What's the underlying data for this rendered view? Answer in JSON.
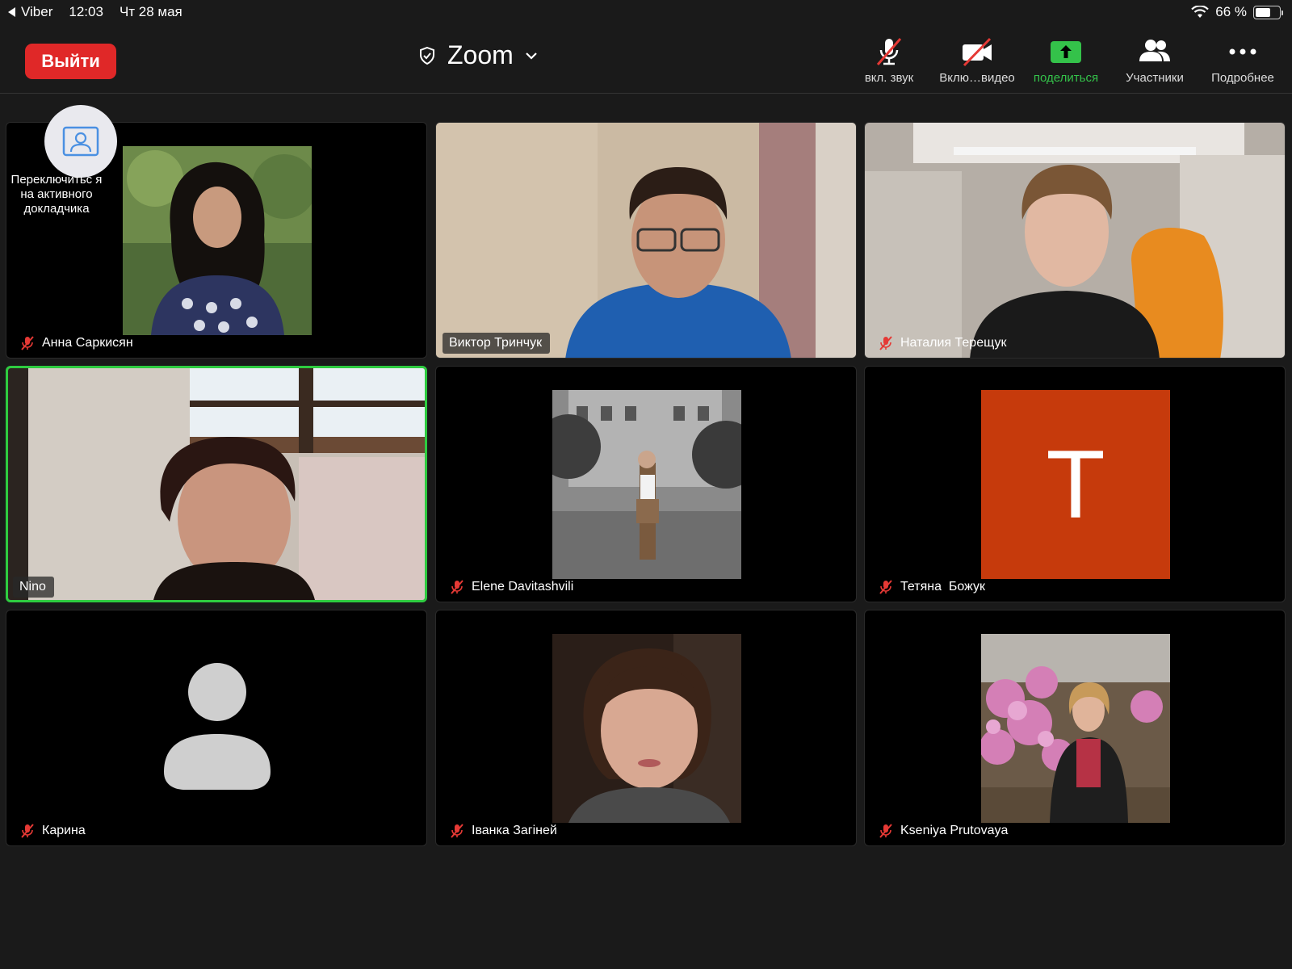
{
  "status_bar": {
    "back_app": "Viber",
    "time": "12:03",
    "date": "Чт 28 мая",
    "battery": "66 %",
    "battery_level": 0.66
  },
  "toolbar": {
    "leave_label": "Выйти",
    "title": "Zoom",
    "buttons": [
      {
        "label": "вкл. звук",
        "icon": "microphone-muted-icon"
      },
      {
        "label": "Вклю…видео",
        "icon": "camera-off-icon"
      },
      {
        "label": "поделиться",
        "icon": "share-screen-icon"
      },
      {
        "label": "Участники",
        "icon": "participants-icon"
      },
      {
        "label": "Подробнее",
        "icon": "more-icon"
      }
    ]
  },
  "speaker_switch": {
    "label": "Переключитьс я на активного докладчика"
  },
  "colors": {
    "leave": "#e02828",
    "share": "#34c24a",
    "active_border": "#2ecc40",
    "mute_red": "#e53935",
    "avatar_t_bg": "#c63a0c"
  },
  "participants": [
    {
      "name": "Анна Саркисян",
      "muted": true,
      "view": "photo"
    },
    {
      "name": "Виктор Тринчук",
      "muted": false,
      "view": "video"
    },
    {
      "name": "Наталия Терещук",
      "muted": true,
      "view": "video"
    },
    {
      "name": "Nino",
      "muted": false,
      "view": "video",
      "active": true
    },
    {
      "name": "Elene Davitashvili",
      "muted": true,
      "view": "photo"
    },
    {
      "name": "Тетяна  Божук",
      "muted": true,
      "view": "initial",
      "initial": "T"
    },
    {
      "name": "Карина",
      "muted": true,
      "view": "placeholder"
    },
    {
      "name": "Іванка Загіней",
      "muted": true,
      "view": "photo"
    },
    {
      "name": "Kseniya Prutovaya",
      "muted": true,
      "view": "photo"
    }
  ]
}
